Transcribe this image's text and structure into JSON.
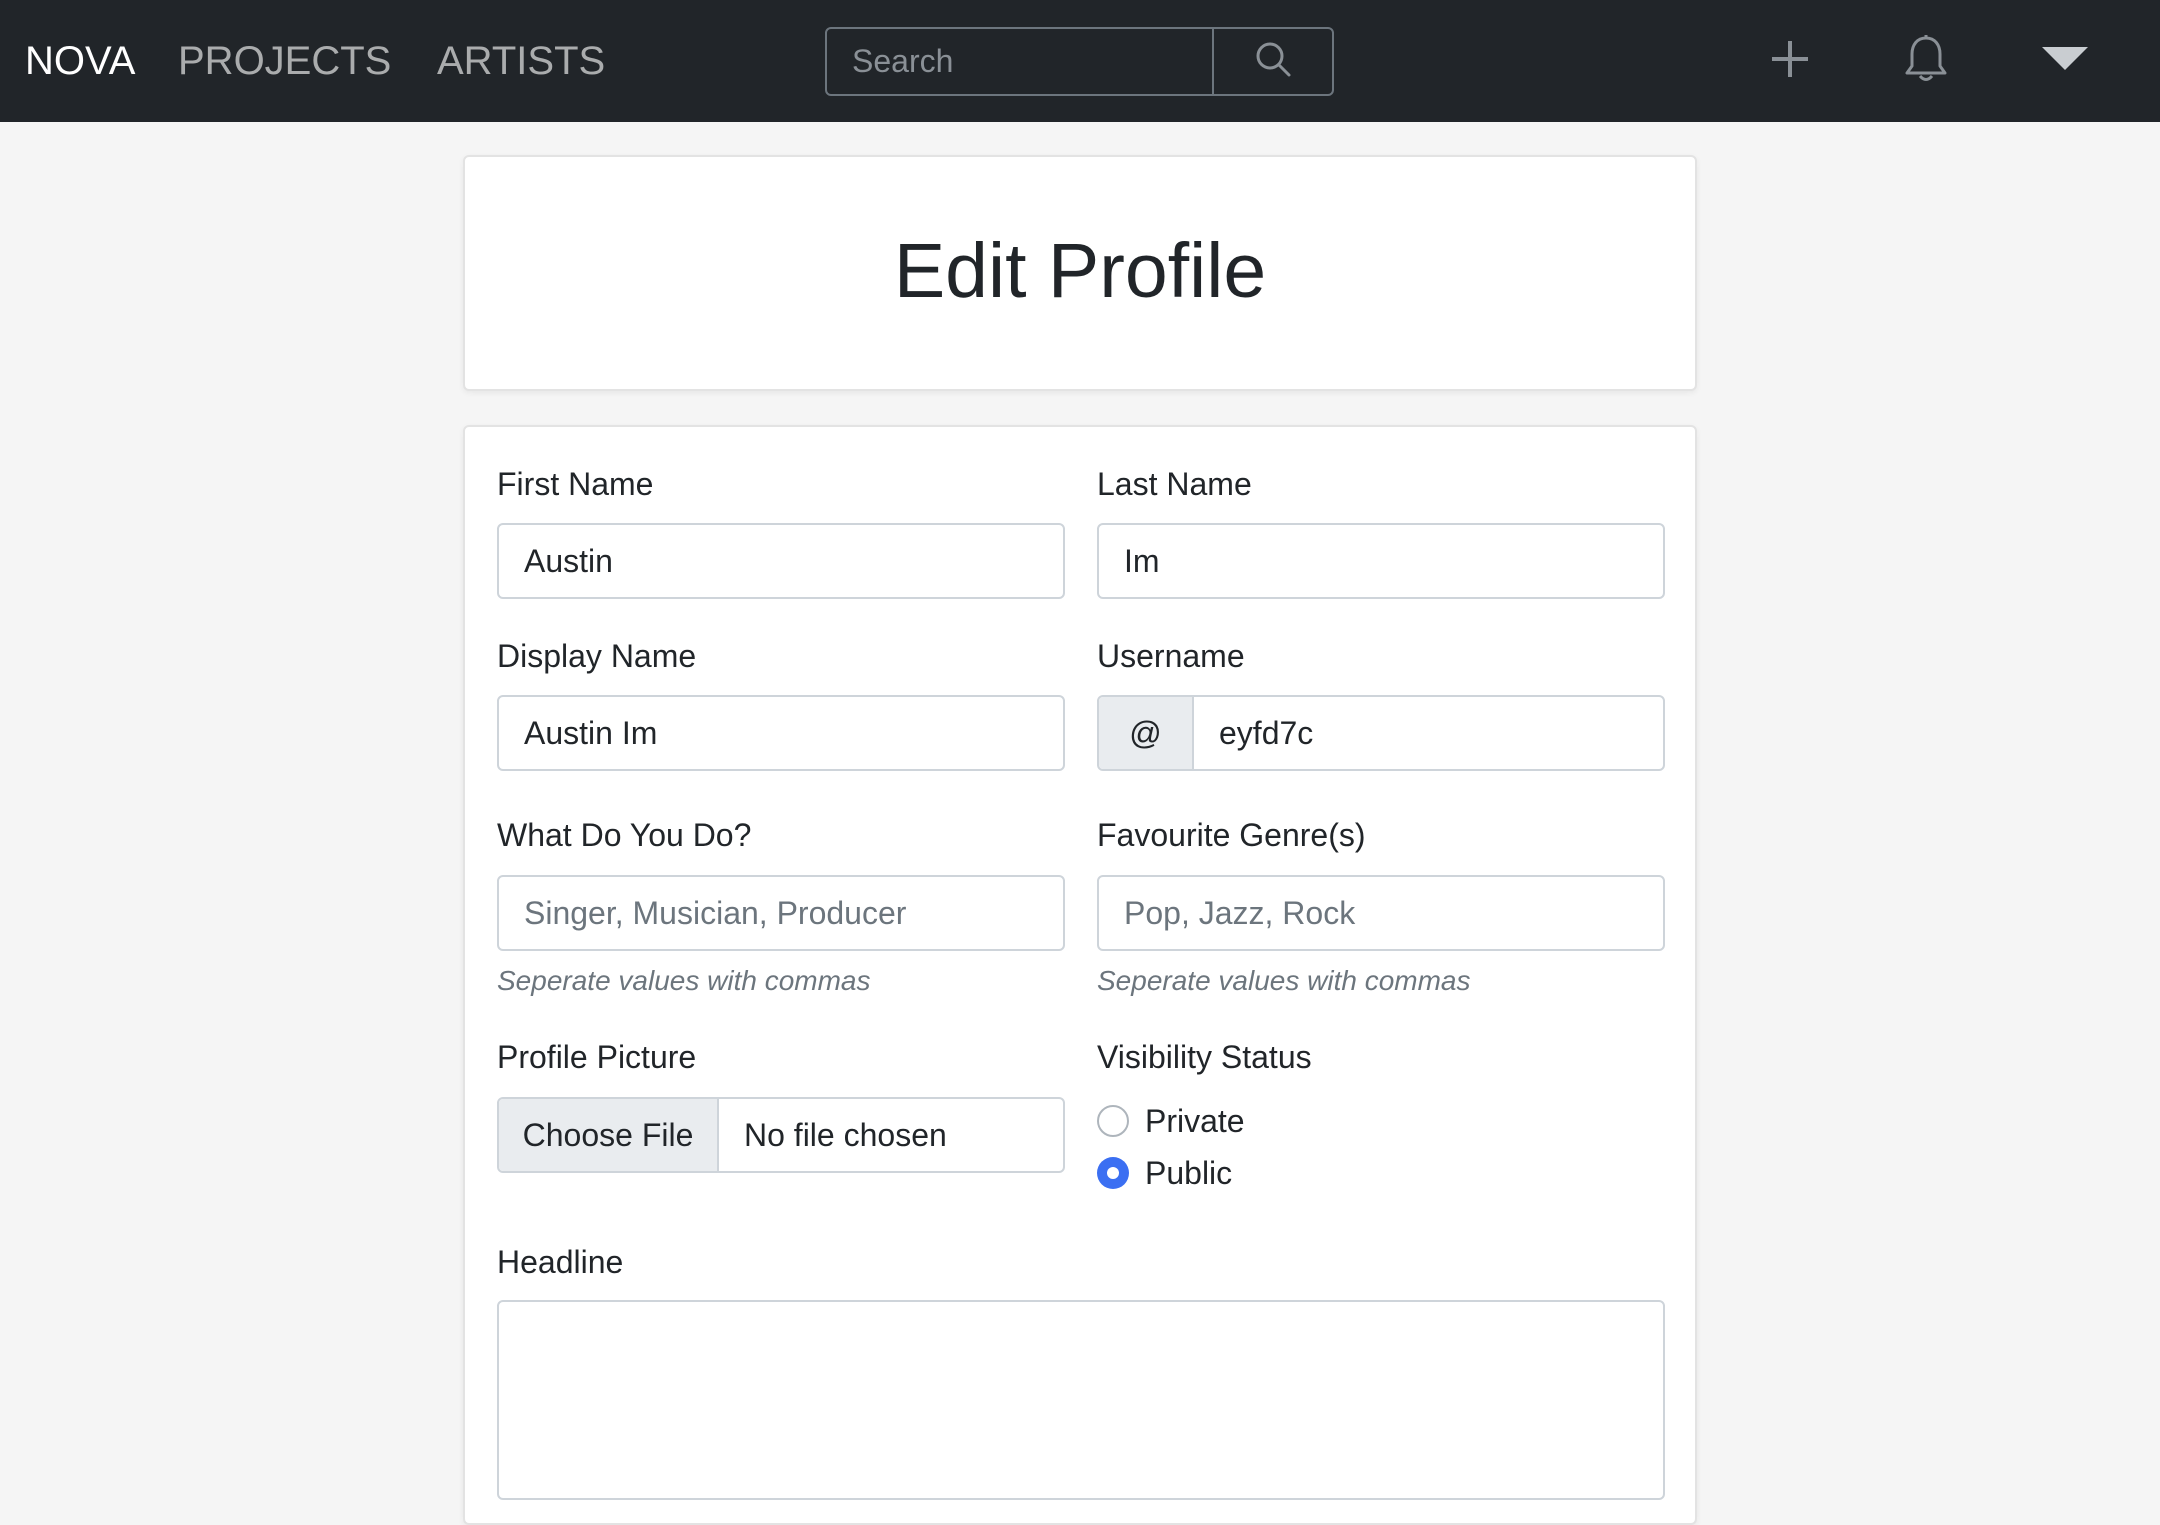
{
  "navbar": {
    "brand": "NOVA",
    "links": [
      "PROJECTS",
      "ARTISTS"
    ],
    "search_placeholder": "Search",
    "icons": [
      "search-icon",
      "plus-icon",
      "bell-icon",
      "caret-down-icon"
    ]
  },
  "header": {
    "title": "Edit Profile"
  },
  "form": {
    "first_name": {
      "label": "First Name",
      "value": "Austin"
    },
    "last_name": {
      "label": "Last Name",
      "value": "Im"
    },
    "display_name": {
      "label": "Display Name",
      "value": "Austin Im"
    },
    "username": {
      "label": "Username",
      "prefix": "@",
      "value": "eyfd7c"
    },
    "what_do_you_do": {
      "label": "What Do You Do?",
      "placeholder": "Singer, Musician, Producer",
      "help": "Seperate values with commas"
    },
    "favourite_genres": {
      "label": "Favourite Genre(s)",
      "placeholder": "Pop, Jazz, Rock",
      "help": "Seperate values with commas"
    },
    "profile_picture": {
      "label": "Profile Picture",
      "button": "Choose File",
      "status": "No file chosen"
    },
    "visibility": {
      "label": "Visibility Status",
      "options": [
        "Private",
        "Public"
      ],
      "selected": "Public"
    },
    "headline": {
      "label": "Headline",
      "value": ""
    }
  },
  "colors": {
    "navbar_bg": "#212529",
    "page_bg": "#f5f5f5",
    "radio_accent": "#3b6ff2"
  }
}
